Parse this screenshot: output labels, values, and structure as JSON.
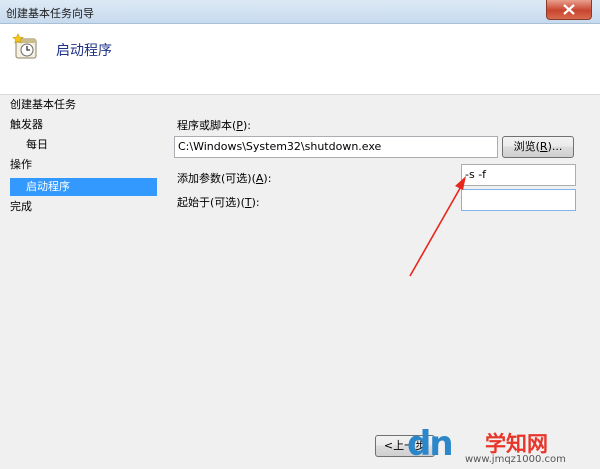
{
  "window": {
    "title": "创建基本任务向导"
  },
  "header": {
    "title": "启动程序"
  },
  "nav": {
    "items": [
      {
        "label": "创建基本任务"
      },
      {
        "label": "触发器"
      },
      {
        "label": "每日"
      },
      {
        "label": "操作"
      },
      {
        "label": "启动程序",
        "selected": true
      },
      {
        "label": "完成"
      }
    ]
  },
  "form": {
    "program_label_pre": "程序或脚本(",
    "program_label_key": "P",
    "program_label_post": "):",
    "program_value": "C:\\Windows\\System32\\shutdown.exe",
    "browse_label_pre": "浏览(",
    "browse_label_key": "R",
    "browse_label_post": ")...",
    "args_label_pre": "添加参数(可选)(",
    "args_label_key": "A",
    "args_label_post": "):",
    "args_value": "-s -f",
    "start_label_pre": "起始于(可选)(",
    "start_label_key": "T",
    "start_label_post": "):",
    "start_value": ""
  },
  "footer": {
    "back_label": "<上一步"
  },
  "watermark": {
    "logo": "dn",
    "brand": "学知网",
    "url": "www.jmqz1000.com"
  },
  "colors": {
    "selection": "#3399ff",
    "header_title": "#1e3287",
    "arrow": "#e8261c"
  }
}
